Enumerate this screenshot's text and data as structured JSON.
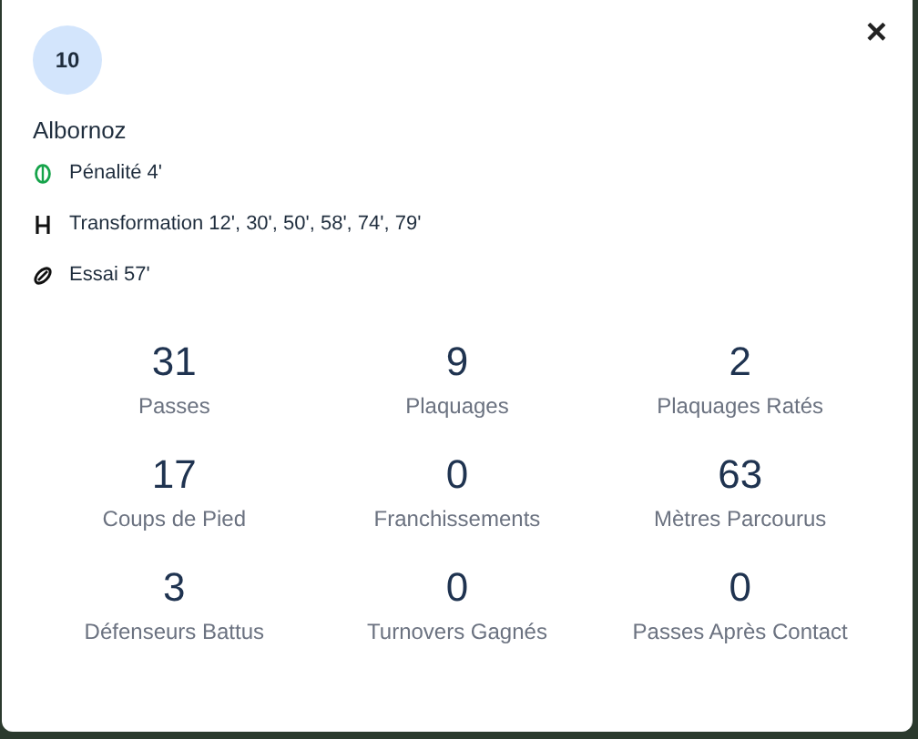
{
  "player": {
    "number": "10",
    "name": "Albornoz"
  },
  "events": [
    {
      "kind": "penalty",
      "text": "Pénalité 4'"
    },
    {
      "kind": "conversion",
      "text": "Transformation 12', 30', 50', 58', 74', 79'"
    },
    {
      "kind": "try",
      "text": "Essai 57'"
    }
  ],
  "close": "×",
  "stats": [
    {
      "value": "31",
      "label": "Passes"
    },
    {
      "value": "9",
      "label": "Plaquages"
    },
    {
      "value": "2",
      "label": "Plaquages Ratés"
    },
    {
      "value": "17",
      "label": "Coups de Pied"
    },
    {
      "value": "0",
      "label": "Franchissements"
    },
    {
      "value": "63",
      "label": "Mètres Parcourus"
    },
    {
      "value": "3",
      "label": "Défenseurs Battus"
    },
    {
      "value": "0",
      "label": "Turnovers Gagnés"
    },
    {
      "value": "0",
      "label": "Passes Après Contact"
    }
  ]
}
